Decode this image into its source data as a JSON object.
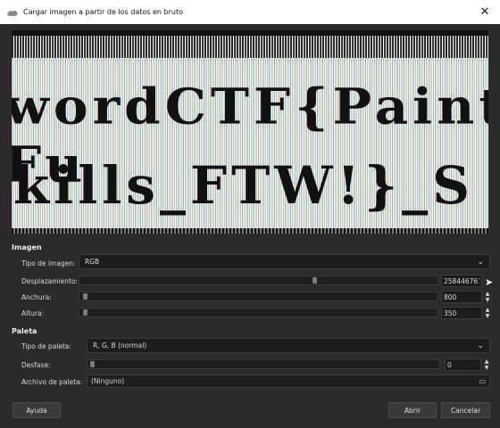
{
  "window": {
    "title": "Cargar imagen a partir de los datos en bruto",
    "close_glyph": "✕"
  },
  "preview": {
    "line1": "wordCTF{Paint Fu",
    "line2": "kills_FTW!}_S"
  },
  "imagen": {
    "section": "Imagen",
    "tipo_label": "Tipo de imagen:",
    "tipo_value": "RGB",
    "desplazamiento_label": "Desplazamiento:",
    "desplazamiento_value": "258446767",
    "desplazamiento_fraction": 0.66,
    "anchura_label": "Anchura:",
    "anchura_value": "800",
    "altura_label": "Altura:",
    "altura_value": "350"
  },
  "paleta": {
    "section": "Paleta",
    "tipo_label": "Tipo de paleta:",
    "tipo_value": "R, G, B (normal)",
    "desfase_label": "Desfase:",
    "desfase_value": "0",
    "archivo_label": "Archivo de paleta:",
    "archivo_value": "(Ninguno)"
  },
  "buttons": {
    "ayuda": "Ayuda",
    "abrir": "Abrir",
    "cancelar": "Cancelar"
  }
}
